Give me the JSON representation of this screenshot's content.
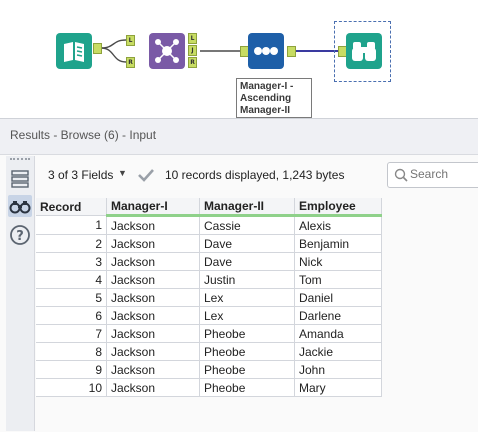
{
  "canvas": {
    "tools": [
      {
        "name": "input",
        "icon": "book-icon",
        "color": "#1fa38c"
      },
      {
        "name": "join",
        "icon": "join-icon",
        "color": "#7a5aa6",
        "anchors": [
          "L",
          "R",
          "L",
          "J",
          "R"
        ]
      },
      {
        "name": "sort",
        "icon": "sort-icon",
        "color": "#1e5fa8",
        "label": "Manager-I - Ascending Manager-II"
      },
      {
        "name": "browse",
        "icon": "binoculars-icon",
        "color": "#1fa38c"
      }
    ]
  },
  "results": {
    "title": "Results - Browse (6) - Input",
    "fields_summary": "3 of 3 Fields",
    "records_summary": "10 records displayed, 1,243 bytes",
    "search_placeholder": "Search",
    "columns": [
      "Record",
      "Manager-I",
      "Manager-II",
      "Employee"
    ],
    "rows": [
      [
        "1",
        "Jackson",
        "Cassie",
        "Alexis"
      ],
      [
        "2",
        "Jackson",
        "Dave",
        "Benjamin"
      ],
      [
        "3",
        "Jackson",
        "Dave",
        "Nick"
      ],
      [
        "4",
        "Jackson",
        "Justin",
        "Tom"
      ],
      [
        "5",
        "Jackson",
        "Lex",
        "Daniel"
      ],
      [
        "6",
        "Jackson",
        "Lex",
        "Darlene"
      ],
      [
        "7",
        "Jackson",
        "Pheobe",
        "Amanda"
      ],
      [
        "8",
        "Jackson",
        "Pheobe",
        "Jackie"
      ],
      [
        "9",
        "Jackson",
        "Pheobe",
        "John"
      ],
      [
        "10",
        "Jackson",
        "Pheobe",
        "Mary"
      ]
    ]
  }
}
